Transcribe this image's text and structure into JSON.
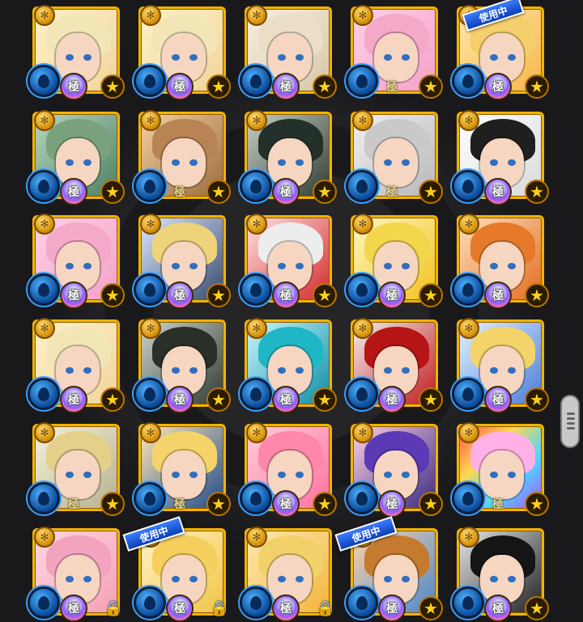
{
  "labels": {
    "kiwami": "極",
    "in_use": "使用中"
  },
  "colors": {
    "frame_gold": "#f2b300",
    "water_blue": "#2f8de6",
    "in_use_blue": "#1f5cff"
  },
  "icons": {
    "rank_medal": "star-medal-icon",
    "element": "water-element-icon",
    "rarity": "gold-star-icon",
    "locked": "lock-icon"
  },
  "cards": [
    {
      "row": 0,
      "col": 0,
      "badge": "kiwami",
      "star": "star",
      "in_use": false,
      "theme": "blonde"
    },
    {
      "row": 0,
      "col": 1,
      "badge": "kiwami",
      "star": "star",
      "in_use": false,
      "theme": "blonde"
    },
    {
      "row": 0,
      "col": 2,
      "badge": "kiwami",
      "star": "star",
      "in_use": false,
      "theme": "beige"
    },
    {
      "row": 0,
      "col": 3,
      "badge": "kiwami-plain",
      "star": "star",
      "in_use": false,
      "theme": "pink"
    },
    {
      "row": 0,
      "col": 4,
      "badge": "kiwami",
      "star": "star",
      "in_use": true,
      "theme": "blonde2"
    },
    {
      "row": 1,
      "col": 0,
      "badge": "kiwami",
      "star": "star",
      "in_use": false,
      "theme": "green"
    },
    {
      "row": 1,
      "col": 1,
      "badge": "kiwami-plain",
      "star": "star",
      "in_use": false,
      "theme": "brown"
    },
    {
      "row": 1,
      "col": 2,
      "badge": "kiwami",
      "star": "star",
      "in_use": false,
      "theme": "dark"
    },
    {
      "row": 1,
      "col": 3,
      "badge": "kiwami-plain",
      "star": "star",
      "in_use": false,
      "theme": "gray"
    },
    {
      "row": 1,
      "col": 4,
      "badge": "kiwami",
      "star": "star",
      "in_use": false,
      "theme": "white"
    },
    {
      "row": 2,
      "col": 0,
      "badge": "kiwami",
      "star": "star",
      "in_use": false,
      "theme": "pink"
    },
    {
      "row": 2,
      "col": 1,
      "badge": "kiwami",
      "star": "star",
      "in_use": false,
      "theme": "navy"
    },
    {
      "row": 2,
      "col": 2,
      "badge": "kiwami",
      "star": "star",
      "in_use": false,
      "theme": "red"
    },
    {
      "row": 2,
      "col": 3,
      "badge": "kiwami",
      "star": "star",
      "in_use": false,
      "theme": "yellow"
    },
    {
      "row": 2,
      "col": 4,
      "badge": "kiwami",
      "star": "star",
      "in_use": false,
      "theme": "orange"
    },
    {
      "row": 3,
      "col": 0,
      "badge": "kiwami",
      "star": "star",
      "in_use": false,
      "theme": "blonde"
    },
    {
      "row": 3,
      "col": 1,
      "badge": "kiwami",
      "star": "star",
      "in_use": false,
      "theme": "dark2"
    },
    {
      "row": 3,
      "col": 2,
      "badge": "kiwami",
      "star": "star",
      "in_use": false,
      "theme": "teal"
    },
    {
      "row": 3,
      "col": 3,
      "badge": "kiwami",
      "star": "star",
      "in_use": false,
      "theme": "chainsaw"
    },
    {
      "row": 3,
      "col": 4,
      "badge": "kiwami",
      "star": "star",
      "in_use": false,
      "theme": "blue"
    },
    {
      "row": 4,
      "col": 0,
      "badge": "kiwami-plain",
      "star": "star",
      "in_use": false,
      "theme": "armor"
    },
    {
      "row": 4,
      "col": 1,
      "badge": "kiwami-plain",
      "star": "star",
      "in_use": false,
      "theme": "pirate"
    },
    {
      "row": 4,
      "col": 2,
      "badge": "kiwami",
      "star": "star",
      "in_use": false,
      "theme": "pink2"
    },
    {
      "row": 4,
      "col": 3,
      "badge": "kiwami",
      "star": "star",
      "in_use": false,
      "theme": "purple"
    },
    {
      "row": 4,
      "col": 4,
      "badge": "kiwami-plain",
      "star": "star",
      "in_use": false,
      "theme": "rainbow"
    },
    {
      "row": 5,
      "col": 0,
      "badge": "kiwami",
      "star": "lock",
      "in_use": false,
      "theme": "pink3"
    },
    {
      "row": 5,
      "col": 1,
      "badge": "kiwami",
      "star": "lock",
      "in_use": true,
      "theme": "yellow2"
    },
    {
      "row": 5,
      "col": 2,
      "badge": "kiwami",
      "star": "lock",
      "in_use": false,
      "theme": "blonde3"
    },
    {
      "row": 5,
      "col": 3,
      "badge": "kiwami",
      "star": "star",
      "in_use": true,
      "theme": "blueface"
    },
    {
      "row": 5,
      "col": 4,
      "badge": "kiwami",
      "star": "star",
      "in_use": false,
      "theme": "black"
    }
  ]
}
